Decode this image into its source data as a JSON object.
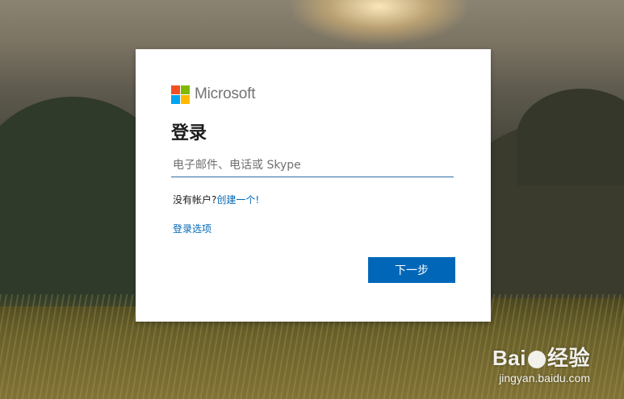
{
  "colors": {
    "accent": "#0067b8",
    "logo_red": "#f25022",
    "logo_green": "#7fba00",
    "logo_blue": "#00a4ef",
    "logo_yellow": "#ffb900"
  },
  "brand": {
    "name": "Microsoft"
  },
  "signin": {
    "title": "登录",
    "email_placeholder": "电子邮件、电话或 Skype",
    "email_value": "",
    "no_account_text": "没有帐户?",
    "create_link": "创建一个!",
    "options_link": "登录选项",
    "next_button": "下一步"
  },
  "watermark": {
    "logo_left": "Bai",
    "logo_right": "经验",
    "url": "jingyan.baidu.com"
  }
}
